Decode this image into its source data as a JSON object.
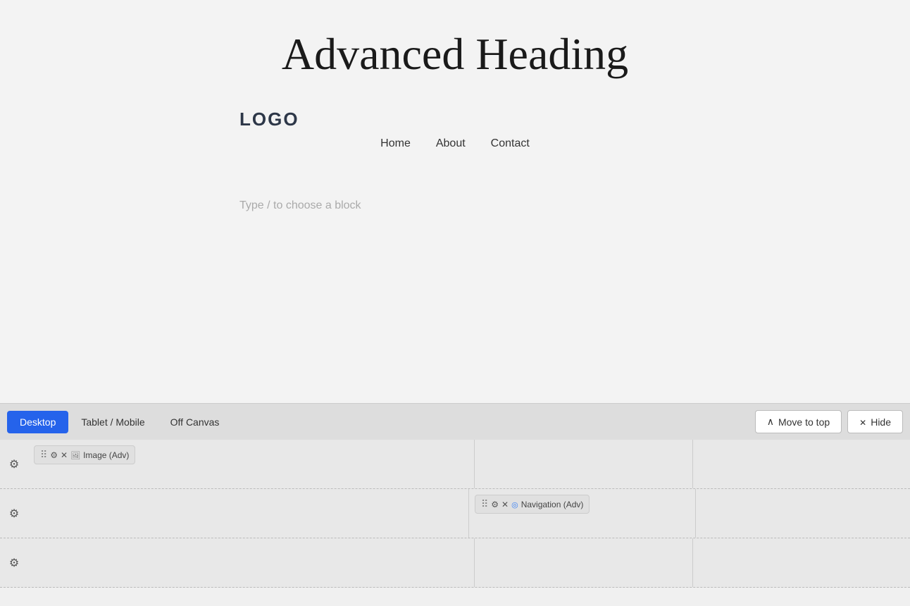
{
  "canvas": {
    "heading": "Advanced Heading",
    "logo": "LOGO",
    "nav": {
      "items": [
        "Home",
        "About",
        "Contact"
      ]
    },
    "placeholder": "Type / to choose a block"
  },
  "toolbar": {
    "tabs": [
      {
        "label": "Desktop",
        "active": true
      },
      {
        "label": "Tablet / Mobile",
        "active": false
      },
      {
        "label": "Off Canvas",
        "active": false
      }
    ],
    "move_to_top": "Move to top",
    "hide": "Hide"
  },
  "block_editor": {
    "rows": [
      {
        "id": "row1",
        "blocks": [
          {
            "id": "image-block",
            "label": "Image (Adv)",
            "icon": "img"
          }
        ]
      },
      {
        "id": "row2",
        "blocks": [
          {
            "id": "nav-block",
            "label": "Navigation (Adv)",
            "icon": "nav"
          }
        ]
      },
      {
        "id": "row3",
        "blocks": []
      }
    ]
  }
}
